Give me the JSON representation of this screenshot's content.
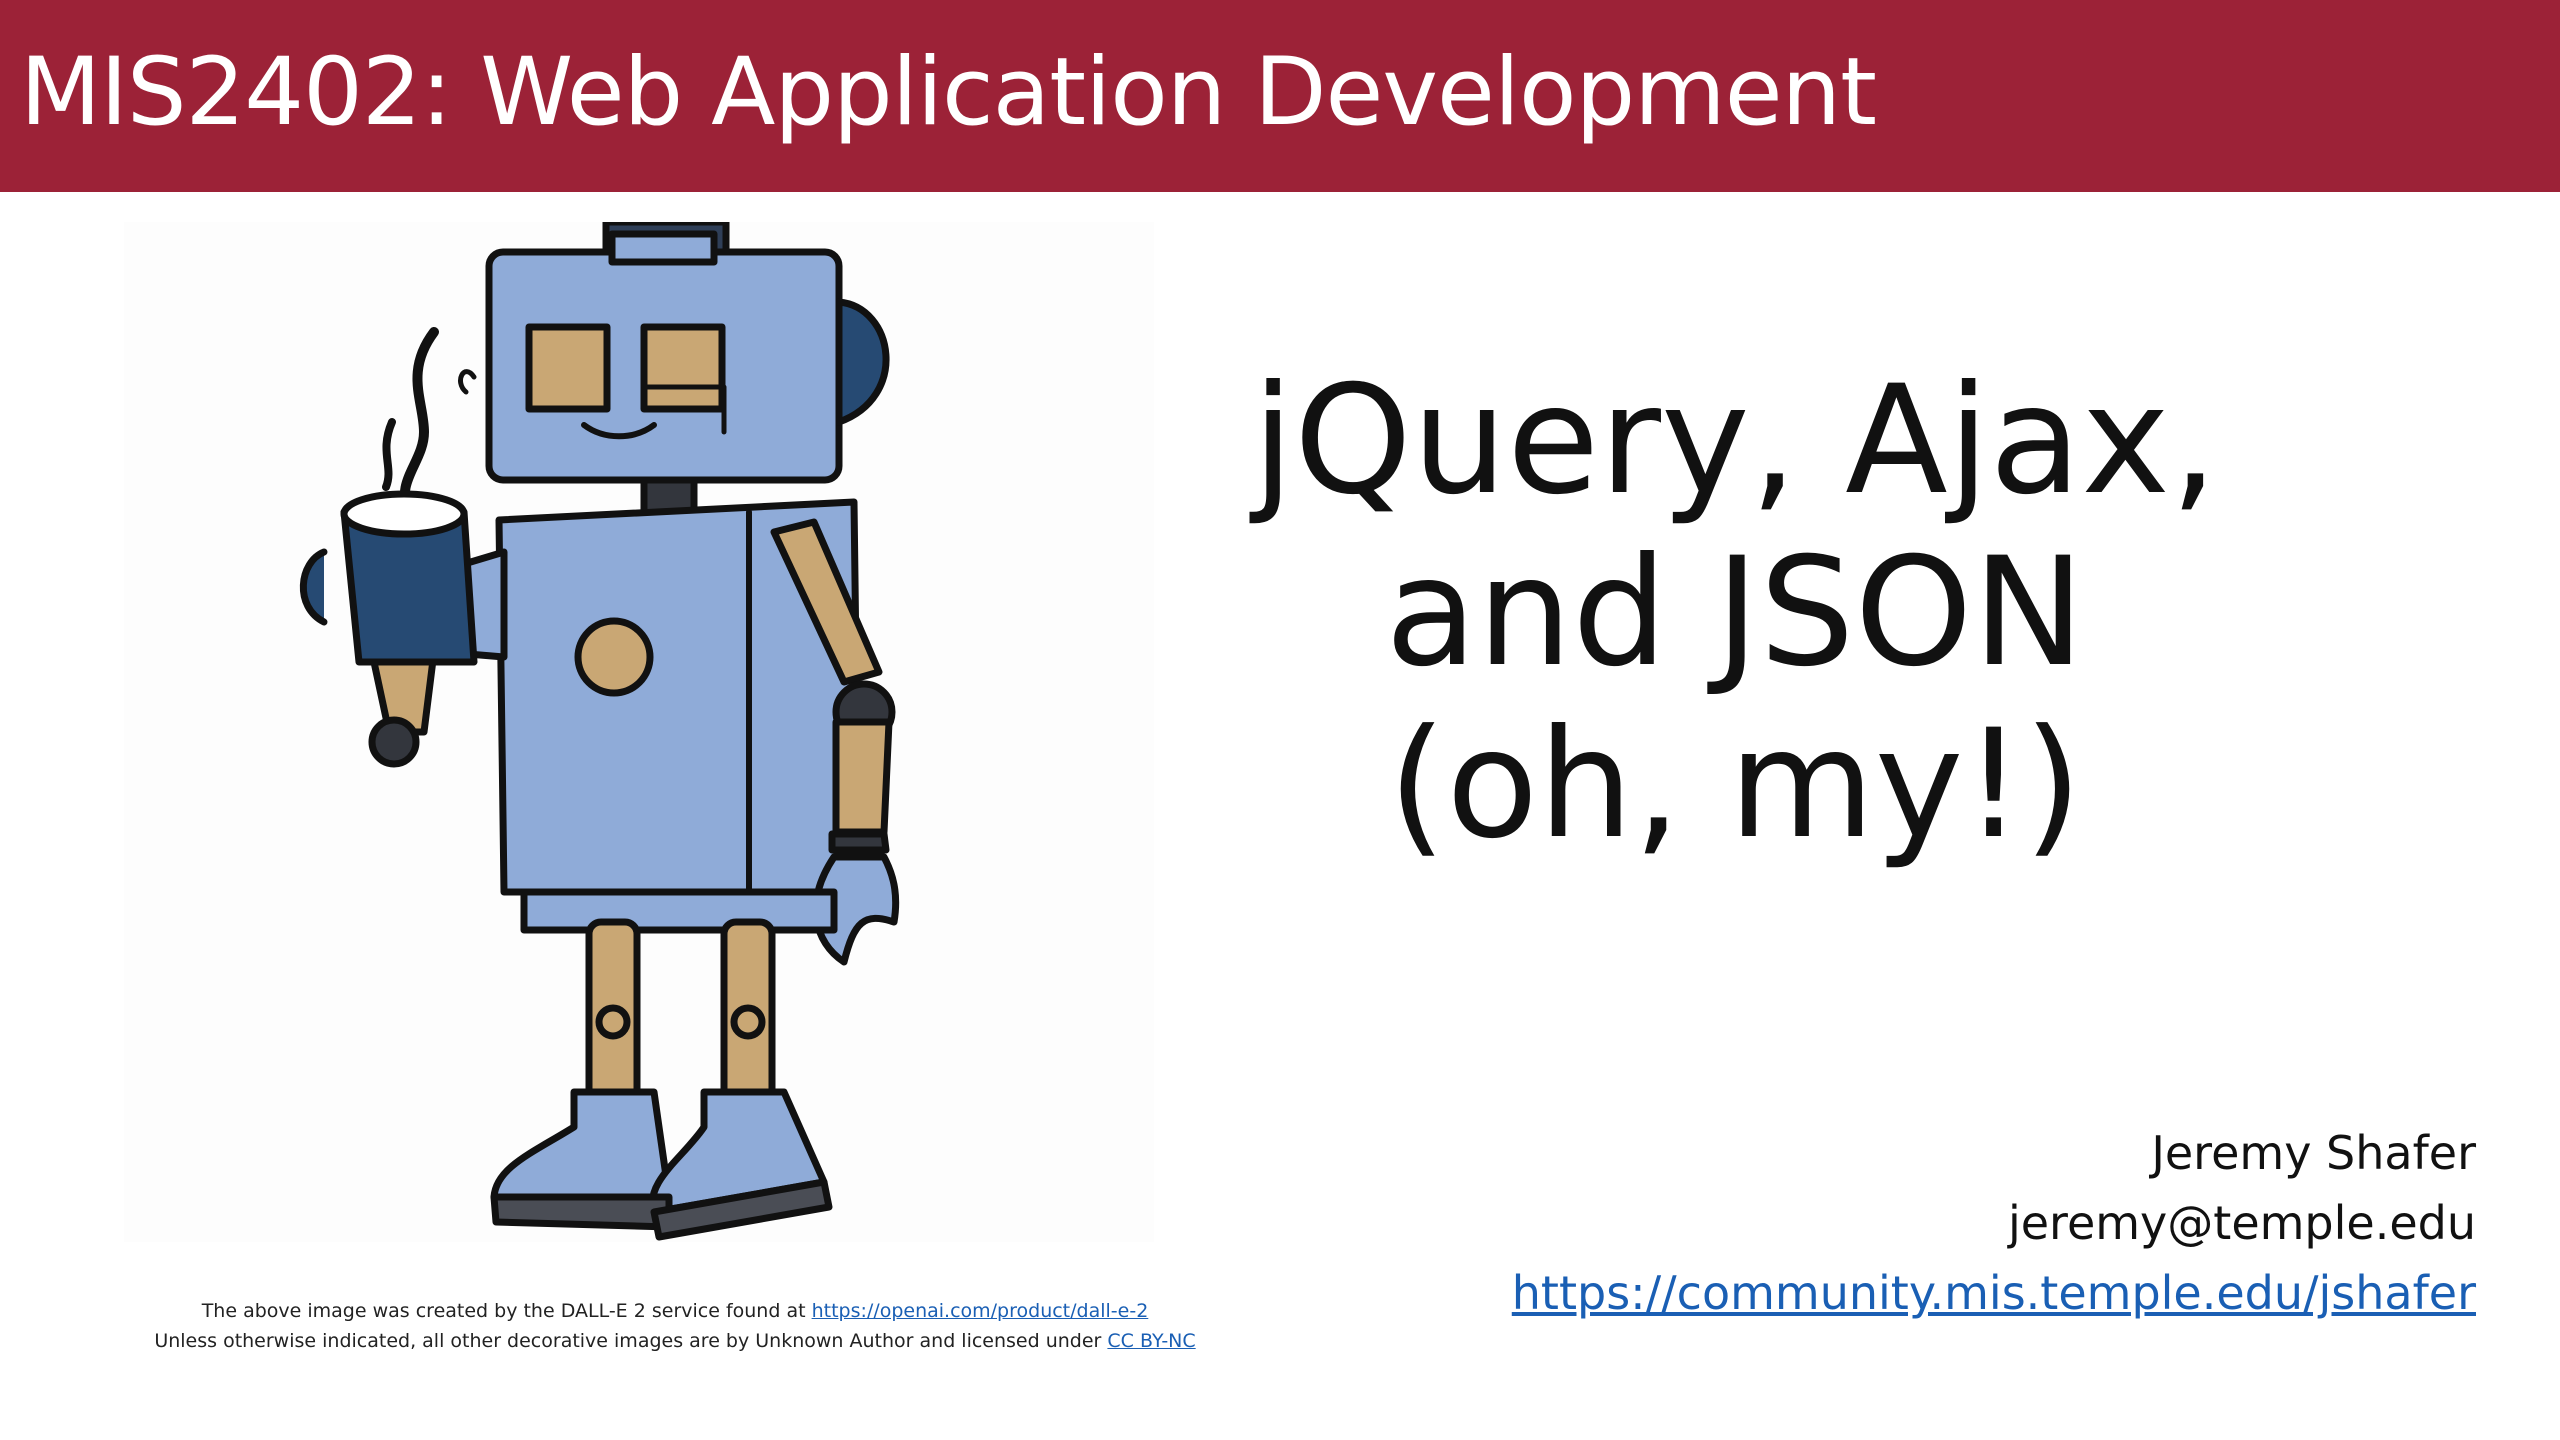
{
  "banner": {
    "title": "MIS2402: Web Application Development",
    "color": "#9c2237"
  },
  "illustration": {
    "name": "robot-with-coffee-mug-illustration",
    "colors": {
      "body": "#8fabd8",
      "mug": "#264a73",
      "limbs": "#c9a774",
      "outline": "#111111"
    }
  },
  "title": {
    "line1": "jQuery, Ajax,",
    "line2": "and JSON",
    "line3": "(oh, my!)"
  },
  "author": {
    "name": "Jeremy Shafer",
    "email": "jeremy@temple.edu",
    "url": "https://community.mis.temple.edu/jshafer",
    "link_color": "#1a5fb4"
  },
  "credits": {
    "line1_text": "The above image was created by the  DALL-E 2 service found at ",
    "line1_link": "https://openai.com/product/dall-e-2",
    "line2_text": "Unless otherwise indicated, all  other decorative images are by Unknown Author and licensed under ",
    "line2_link": "CC BY-NC"
  }
}
